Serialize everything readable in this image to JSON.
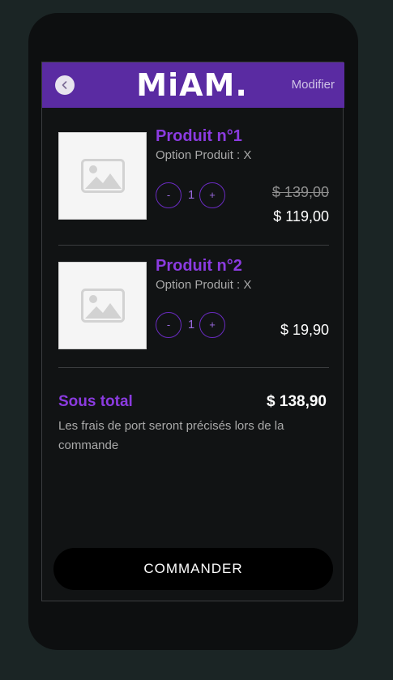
{
  "header": {
    "back_icon": "chevron-left-icon",
    "logo_text": "MiAM.",
    "edit_label": "Modifier",
    "accent_color": "#5a2ba2"
  },
  "cart": {
    "items": [
      {
        "name": "Produit n°1",
        "option": "Option Produit : X",
        "quantity": "1",
        "minus_label": "-",
        "plus_label": "+",
        "old_price": "$ 139,00",
        "price": "$ 119,00",
        "image_icon": "image-placeholder-icon"
      },
      {
        "name": "Produit n°2",
        "option": "Option Produit : X",
        "quantity": "1",
        "minus_label": "-",
        "plus_label": "+",
        "price": "$ 19,90",
        "image_icon": "image-placeholder-icon"
      }
    ],
    "subtotal_label": "Sous total",
    "subtotal_value": "$ 138,90",
    "shipping_note": "Les frais de port seront précisés lors de la commande",
    "order_label": "COMMANDER"
  },
  "colors": {
    "product_name": "#8b3be0",
    "phone_bg": "#0d0f10",
    "page_bg": "#1b2525"
  }
}
